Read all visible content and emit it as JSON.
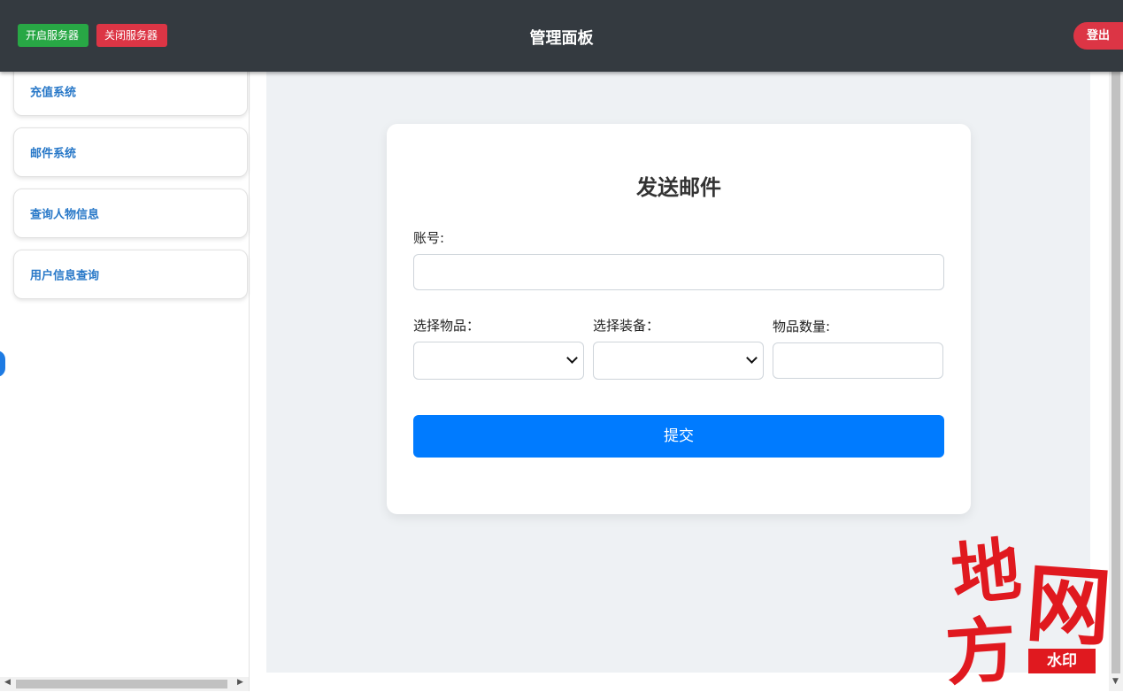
{
  "header": {
    "start_server": "开启服务器",
    "stop_server": "关闭服务器",
    "title": "管理面板",
    "logout": "登出"
  },
  "sidebar": {
    "items": [
      {
        "label": "充值系统"
      },
      {
        "label": "邮件系统"
      },
      {
        "label": "查询人物信息"
      },
      {
        "label": "用户信息查询"
      }
    ]
  },
  "form": {
    "title": "发送邮件",
    "account_label": "账号:",
    "account_value": "",
    "item_label": "选择物品：",
    "item_selected": "",
    "equipment_label": "选择装备：",
    "equipment_selected": "",
    "quantity_label": "物品数量:",
    "quantity_value": "",
    "submit": "提交"
  },
  "watermark": {
    "chars": [
      "地",
      "网",
      "方"
    ],
    "badge": "水印"
  },
  "colors": {
    "topbar": "#343a40",
    "start_button": "#28a745",
    "stop_button": "#dc3545",
    "primary": "#007bff",
    "sidebar_link": "#2878c8",
    "main_bg": "#eef1f4",
    "watermark": "#e0191f"
  }
}
